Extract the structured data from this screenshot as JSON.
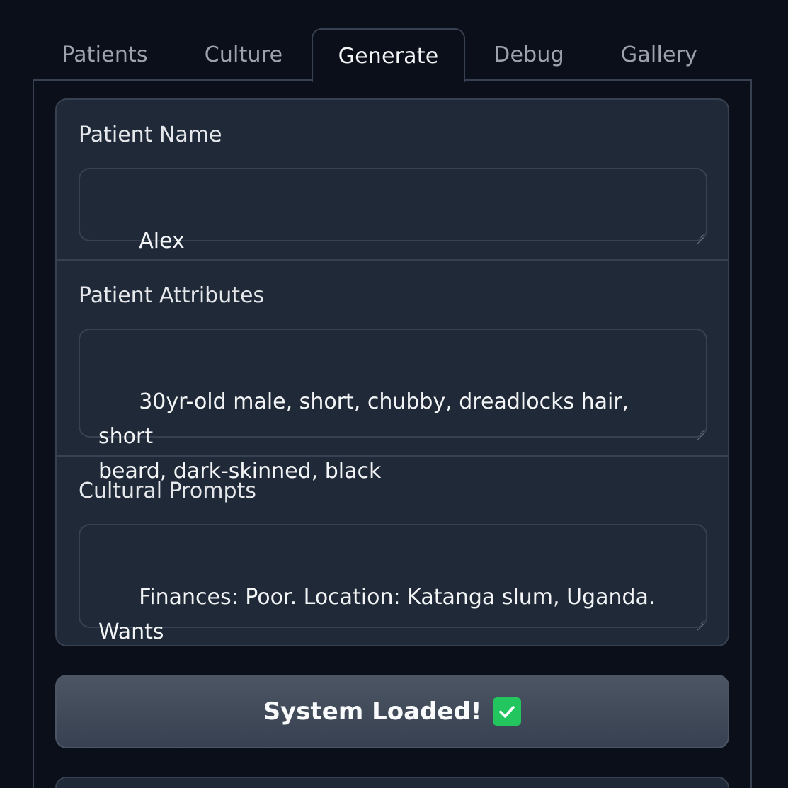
{
  "tabs": [
    {
      "label": "Patients",
      "active": false
    },
    {
      "label": "Culture",
      "active": false
    },
    {
      "label": "Generate",
      "active": true
    },
    {
      "label": "Debug",
      "active": false
    },
    {
      "label": "Gallery",
      "active": false
    }
  ],
  "form": {
    "patient_name": {
      "label": "Patient Name",
      "value": "Alex"
    },
    "patient_attributes": {
      "label": "Patient Attributes",
      "value": "30yr-old male, short, chubby, dreadlocks hair, short\nbeard, dark-skinned, black"
    },
    "cultural_prompts": {
      "label": "Cultural Prompts",
      "value": "Finances: Poor. Location: Katanga slum, Uganda. Wants\ncartoon: True."
    }
  },
  "status_button": {
    "label": "System Loaded!",
    "icon": "check-mark-icon",
    "icon_color": "#22c55e"
  },
  "colors": {
    "background": "#0b0f19",
    "card": "#1f2937",
    "border": "#374151",
    "accent": "#22c55e"
  }
}
